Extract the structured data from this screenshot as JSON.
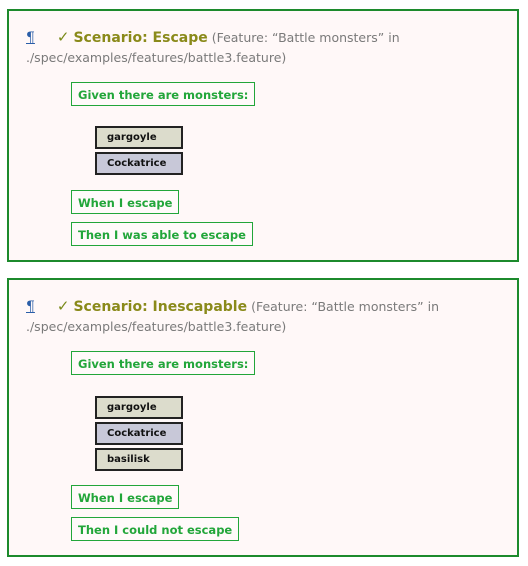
{
  "scenarios": [
    {
      "pilcrow": "¶",
      "check": "✓",
      "title": "Scenario: Escape",
      "feature_line": "(Feature: “Battle monsters” in ./spec/examples/features/battle3.feature)",
      "given": "Given there are monsters:",
      "monsters": [
        "gargoyle",
        "Cockatrice"
      ],
      "when": "When I escape",
      "then": "Then I was able to escape"
    },
    {
      "pilcrow": "¶",
      "check": "✓",
      "title": "Scenario: Inescapable",
      "feature_line": "(Feature: “Battle monsters” in ./spec/examples/features/battle3.feature)",
      "given": "Given there are monsters:",
      "monsters": [
        "gargoyle",
        "Cockatrice",
        "basilisk"
      ],
      "when": "When I escape",
      "then": "Then I could not escape"
    }
  ],
  "colors": {
    "border": "#1c8a2c",
    "step_text": "#22a63a",
    "title": "#8a8a1a",
    "link": "#2a5ea8",
    "background": "#fff8f8"
  },
  "icons": {
    "anchor": "pilcrow-icon",
    "status": "checkmark-icon"
  }
}
